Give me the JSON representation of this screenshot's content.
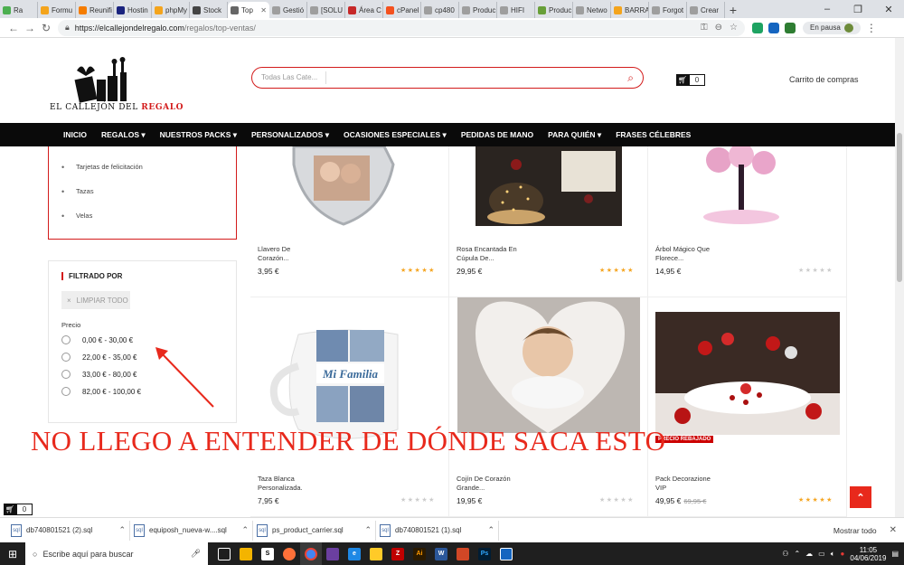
{
  "browser": {
    "tabs": [
      {
        "label": "Ra",
        "color": "#4caf50"
      },
      {
        "label": "Formu",
        "color": "#f4a41c"
      },
      {
        "label": "Reunifi",
        "color": "#f57c00"
      },
      {
        "label": "Hostin",
        "color": "#1a237e"
      },
      {
        "label": "phpMy",
        "color": "#f4a41c"
      },
      {
        "label": "Stock",
        "color": "#444444"
      },
      {
        "label": "Top",
        "color": "#666666"
      },
      {
        "label": "Gestió",
        "color": "#9e9e9e"
      },
      {
        "label": "[SOLU",
        "color": "#9e9e9e"
      },
      {
        "label": "Área C",
        "color": "#c62828"
      },
      {
        "label": "cPanel",
        "color": "#f4511e"
      },
      {
        "label": "cp480",
        "color": "#9e9e9e"
      },
      {
        "label": "Produc",
        "color": "#9e9e9e"
      },
      {
        "label": "HIFI",
        "color": "#9e9e9e"
      },
      {
        "label": "Produc",
        "color": "#689f38"
      },
      {
        "label": "Netwo",
        "color": "#9e9e9e"
      },
      {
        "label": "BARRA",
        "color": "#f4a41c"
      },
      {
        "label": "Forgot",
        "color": "#9e9e9e"
      },
      {
        "label": "Crear",
        "color": "#9e9e9e"
      }
    ],
    "url_domain": "https://elcallejondelregalo.com",
    "url_path": "/regalos/top-ventas/",
    "pause_label": "En pausa"
  },
  "header": {
    "logo_text_main": "EL CALLEJÓN DEL",
    "logo_text_accent": "REGALO",
    "search_placeholder": "Todas Las Cate...",
    "cart_count": "0",
    "cart_label": "Carrito de compras"
  },
  "nav": {
    "items": [
      "INICIO",
      "REGALOS ▾",
      "NUESTROS PACKS ▾",
      "PERSONALIZADOS ▾",
      "OCASIONES ESPECIALES ▾",
      "PEDIDAS DE MANO",
      "PARA QUIÉN ▾",
      "FRASES CÉLEBRES"
    ]
  },
  "sidebar": {
    "categories": [
      "Tarjetas de felicitación",
      "Tazas",
      "Velas"
    ],
    "filter_title": "FILTRADO POR",
    "clear_label": "LIMPIAR TODO",
    "price_label": "Precio",
    "price_ranges": [
      "0,00 € - 30,00 €",
      "22,00 € - 35,00 €",
      "33,00 € - 80,00 €",
      "82,00 € - 100,00 €"
    ]
  },
  "products": [
    {
      "name": "Llavero De Corazón...",
      "price": "3,95 €",
      "rating": 5
    },
    {
      "name": "Rosa Encantada En Cúpula De...",
      "price": "29,95 €",
      "rating": 5
    },
    {
      "name": "Árbol Mágico Que Florece...",
      "price": "14,95 €",
      "rating": 0
    },
    {
      "name": "Taza Blanca Personalizada.",
      "price": "7,95 €",
      "rating": 0
    },
    {
      "name": "Cojín De Corazón Grande...",
      "price": "19,95 €",
      "rating": 0
    },
    {
      "name": "Pack Decorazione VIP",
      "price": "49,95 €",
      "old_price": "69,95 €",
      "rating": 5,
      "badge": "PRECIO REBAJADO"
    }
  ],
  "annotation": "NO LLEGO A ENTENDER DE DÓNDE SACA ESTO",
  "minicart_count": "0",
  "downloads": {
    "items": [
      "db740801521 (2).sql",
      "equiposh_nueva-w....sql",
      "ps_product_carrier.sql",
      "db740801521 (1).sql"
    ],
    "show_all": "Mostrar todo"
  },
  "taskbar": {
    "search_placeholder": "Escribe aquí para buscar",
    "time": "11:05",
    "date": "04/06/2019"
  }
}
